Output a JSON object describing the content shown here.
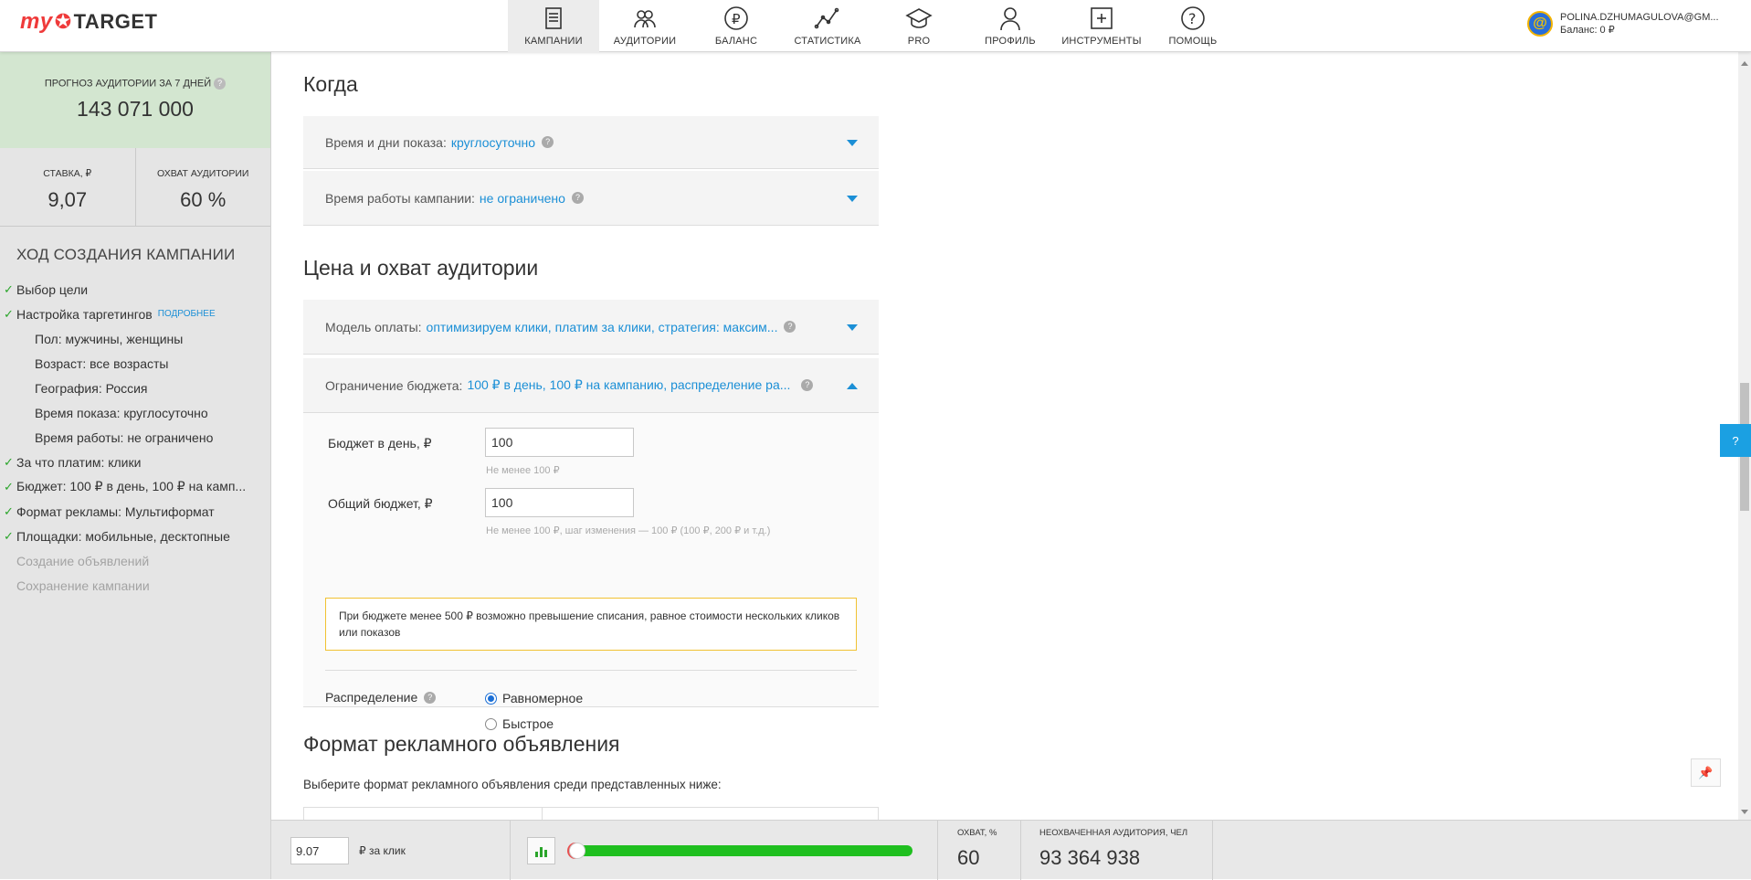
{
  "header": {
    "logo_my": "my",
    "logo_target": "TARGET",
    "nav": [
      {
        "label": "КАМПАНИИ",
        "icon": "campaigns-icon",
        "active": true
      },
      {
        "label": "АУДИТОРИИ",
        "icon": "audiences-icon",
        "active": false
      },
      {
        "label": "БАЛАНС",
        "icon": "balance-icon",
        "active": false
      },
      {
        "label": "СТАТИСТИКА",
        "icon": "statistics-icon",
        "active": false
      },
      {
        "label": "PRO",
        "icon": "pro-icon",
        "active": false
      },
      {
        "label": "ПРОФИЛЬ",
        "icon": "profile-icon",
        "active": false
      },
      {
        "label": "ИНСТРУМЕНТЫ",
        "icon": "tools-icon",
        "active": false
      },
      {
        "label": "ПОМОЩЬ",
        "icon": "help-icon",
        "active": false
      }
    ],
    "user": {
      "avatar": "@",
      "email": "POLINA.DZHUMAGULOVA@GM...",
      "balance": "Баланс: 0 ₽"
    }
  },
  "sidebar": {
    "forecast_label": "ПРОГНОЗ АУДИТОРИИ ЗА 7 ДНЕЙ",
    "forecast_help": "?",
    "forecast_value": "143 071 000",
    "bid_label": "СТАВКА, ₽",
    "bid_value": "9,07",
    "coverage_label": "ОХВАТ АУДИТОРИИ",
    "coverage_value": "60 %",
    "progress_title": "ХОД СОЗДАНИЯ КАМПАНИИ",
    "steps": [
      {
        "label": "Выбор цели",
        "type": "done"
      },
      {
        "label": "Настройка таргетингов",
        "type": "done",
        "more": "ПОДРОБНЕЕ"
      },
      {
        "label": "Пол: мужчины, женщины",
        "type": "sub"
      },
      {
        "label": "Возраст: все возрасты",
        "type": "sub"
      },
      {
        "label": "География: Россия",
        "type": "sub"
      },
      {
        "label": "Время показа: круглосуточно",
        "type": "sub"
      },
      {
        "label": "Время работы: не ограничено",
        "type": "sub"
      },
      {
        "label": "За что платим: клики",
        "type": "done"
      },
      {
        "label": "Бюджет: 100 ₽ в день, 100 ₽ на камп...",
        "type": "done"
      },
      {
        "label": "Формат рекламы: Мультиформат",
        "type": "done"
      },
      {
        "label": "Площадки: мобильные, десктопные",
        "type": "done"
      },
      {
        "label": "Создание объявлений",
        "type": "disabled"
      },
      {
        "label": "Сохранение кампании",
        "type": "disabled"
      }
    ]
  },
  "main": {
    "when_title": "Когда",
    "schedule_label": "Время и дни показа:",
    "schedule_value": "круглосуточно",
    "runtime_label": "Время работы кампании:",
    "runtime_value": "не ограничено",
    "price_title": "Цена и охват аудитории",
    "payment_label": "Модель оплаты:",
    "payment_value": "оптимизируем клики, платим за клики, стратегия: максим...",
    "budget_label": "Ограничение бюджета:",
    "budget_value": "100 ₽ в день, 100 ₽ на кампанию, распределение ра...",
    "daily_label": "Бюджет в день, ₽",
    "daily_value": "100",
    "daily_hint": "Не менее 100 ₽",
    "total_label": "Общий бюджет, ₽",
    "total_value": "100",
    "total_hint": "Не менее 100 ₽, шаг изменения — 100 ₽ (100 ₽, 200 ₽ и т.д.)",
    "warning": "При бюджете менее 500 ₽ возможно превышение списания, равное стоимости нескольких кликов или показов",
    "distribution_label": "Распределение",
    "dist_options": [
      {
        "label": "Равномерное",
        "checked": true
      },
      {
        "label": "Быстрое",
        "checked": false
      }
    ],
    "format_title": "Формат рекламного объявления",
    "format_desc": "Выберите формат рекламного объявления среди представленных ниже:",
    "help_tab": "?",
    "help_mark": "?"
  },
  "bottom": {
    "bid_value": "9.07",
    "bid_unit": "₽ за клик",
    "slider_level": 0.0,
    "reach_label": "ОХВАТ, %",
    "reach_value": "60",
    "unreached_label": "НЕОХВАЧЕННАЯ АУДИТОРИЯ, ЧЕЛ",
    "unreached_value": "93 364 938"
  },
  "colors": {
    "accent": "#1b8fd6",
    "forecast_bg": "#d3e6d0",
    "slider": "#1fbf1f",
    "warning_border": "#f1c232",
    "logo": "#ef3a3a"
  }
}
